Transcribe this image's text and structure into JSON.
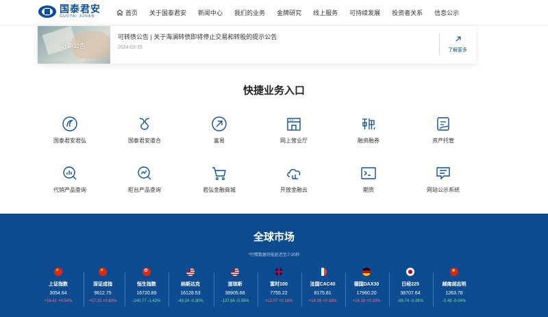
{
  "logo": {
    "cn": "国泰君安",
    "en": "GUOTAI JUNAN"
  },
  "nav": [
    {
      "label": "首页",
      "icon": "home-icon"
    },
    {
      "label": "关于国泰君安"
    },
    {
      "label": "新闻中心"
    },
    {
      "label": "我们的业务"
    },
    {
      "label": "金牌研究"
    },
    {
      "label": "线上服务"
    },
    {
      "label": "可持续发展"
    },
    {
      "label": "投资者关系"
    },
    {
      "label": "信息公示"
    }
  ],
  "notice": {
    "image_label": "近期公告",
    "title": "可转债公告 | 关于海澜转债即将停止交易和转股的提示公告",
    "date": "2024-03-15",
    "more": "了解更多"
  },
  "quick": {
    "title": "快捷业务入口",
    "items": [
      {
        "label": "国泰君安君弘",
        "icon": "junhong-app-icon"
      },
      {
        "label": "国泰君安道合",
        "icon": "daohe-app-icon"
      },
      {
        "label": "富易",
        "icon": "fuyi-icon"
      },
      {
        "label": "网上营业厅",
        "icon": "online-hall-icon"
      },
      {
        "label": "融资融券",
        "icon": "margin-trading-icon"
      },
      {
        "label": "资产托管",
        "icon": "asset-custody-icon"
      },
      {
        "label": "代销产品查询",
        "icon": "product-query-icon"
      },
      {
        "label": "柜台产品查询",
        "icon": "counter-product-icon"
      },
      {
        "label": "君弘金融商城",
        "icon": "shopping-cart-icon"
      },
      {
        "label": "开放金融云",
        "icon": "cloud-icon"
      },
      {
        "label": "期货",
        "icon": "futures-terminal-icon"
      },
      {
        "label": "网站公示系统",
        "icon": "announcement-icon"
      }
    ]
  },
  "market": {
    "title": "全球市场",
    "note": "*行情数据可能延迟至少20秒",
    "indices": [
      {
        "name": "上证指数",
        "value": "3054.64",
        "change": "+16.41 +0.54%",
        "dir": "up",
        "flag": "cn"
      },
      {
        "name": "深证成指",
        "value": "9612.75",
        "change": "+57.33 +0.60%",
        "dir": "up",
        "flag": "cn"
      },
      {
        "name": "恒生指数",
        "value": "16720.89",
        "change": "-240.77 -1.42%",
        "dir": "down",
        "flag": "hk"
      },
      {
        "name": "纳斯达克",
        "value": "16128.53",
        "change": "-49.24 -0.30%",
        "dir": "down",
        "flag": "us"
      },
      {
        "name": "道琼斯",
        "value": "38905.66",
        "change": "-137.66 -0.35%",
        "dir": "down",
        "flag": "us"
      },
      {
        "name": "富时100",
        "value": "7755.22",
        "change": "+12.07 +0.16%",
        "dir": "up",
        "flag": "uk"
      },
      {
        "name": "法国CAC40",
        "value": "8175.81",
        "change": "+14.39 +0.18%",
        "dir": "up",
        "flag": "fr"
      },
      {
        "name": "德国DAX30",
        "value": "17960.20",
        "change": "+18.18 +0.10%",
        "dir": "up",
        "flag": "de"
      },
      {
        "name": "日经225",
        "value": "38707.64",
        "change": "-99.74 -0.26%",
        "dir": "down",
        "flag": "jp"
      },
      {
        "name": "越南胡志明",
        "value": "1263.78",
        "change": "-0.48 -0.04%",
        "dir": "down",
        "flag": "vn"
      }
    ]
  },
  "colors": {
    "brand": "#0a4d9c",
    "market_bg": "#0e4c92",
    "up": "#ff7070",
    "down": "#7fe089"
  }
}
